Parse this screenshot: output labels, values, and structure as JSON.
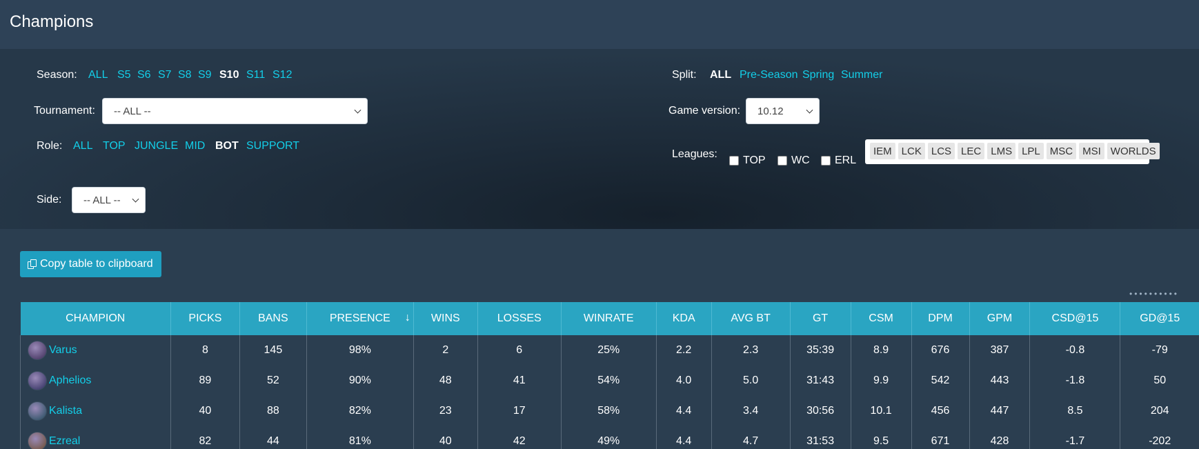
{
  "page": {
    "title": "Champions"
  },
  "filters": {
    "season_label": "Season:",
    "seasons": [
      {
        "label": "ALL",
        "active": false
      },
      {
        "label": "S5",
        "active": false
      },
      {
        "label": "S6",
        "active": false
      },
      {
        "label": "S7",
        "active": false
      },
      {
        "label": "S8",
        "active": false
      },
      {
        "label": "S9",
        "active": false
      },
      {
        "label": "S10",
        "active": true
      },
      {
        "label": "S11",
        "active": false
      },
      {
        "label": "S12",
        "active": false
      }
    ],
    "split_label": "Split:",
    "splits": [
      {
        "label": "ALL",
        "active": true
      },
      {
        "label": "Pre-Season",
        "active": false
      },
      {
        "label": "Spring",
        "active": false
      },
      {
        "label": "Summer",
        "active": false
      }
    ],
    "tournament_label": "Tournament:",
    "tournament_value": "-- ALL --",
    "game_version_label": "Game version:",
    "game_version_value": "10.12",
    "role_label": "Role:",
    "roles": [
      {
        "label": "ALL",
        "active": false
      },
      {
        "label": "TOP",
        "active": false
      },
      {
        "label": "JUNGLE",
        "active": false
      },
      {
        "label": "MID",
        "active": false
      },
      {
        "label": "BOT",
        "active": true
      },
      {
        "label": "SUPPORT",
        "active": false
      }
    ],
    "leagues_label": "Leagues:",
    "league_checkboxes": [
      "TOP",
      "WC",
      "ERL"
    ],
    "league_tags": [
      "IEM",
      "LCK",
      "LCS",
      "LEC",
      "LMS",
      "LPL",
      "MSC",
      "MSI",
      "WORLDS"
    ],
    "side_label": "Side:",
    "side_value": "-- ALL --"
  },
  "actions": {
    "copy_label": "Copy table to clipboard"
  },
  "table": {
    "columns": [
      "CHAMPION",
      "PICKS",
      "BANS",
      "PRESENCE",
      "WINS",
      "LOSSES",
      "WINRATE",
      "KDA",
      "AVG BT",
      "GT",
      "CSM",
      "DPM",
      "GPM",
      "CSD@15",
      "GD@15"
    ],
    "sort_arrow": "↓",
    "rows": [
      {
        "champion": "Varus",
        "cells": [
          "8",
          "145",
          "98%",
          "2",
          "6",
          "25%",
          "2.2",
          "2.3",
          "35:39",
          "8.9",
          "676",
          "387",
          "-0.8",
          "-79"
        ]
      },
      {
        "champion": "Aphelios",
        "cells": [
          "89",
          "52",
          "90%",
          "48",
          "41",
          "54%",
          "4.0",
          "5.0",
          "31:43",
          "9.9",
          "542",
          "443",
          "-1.8",
          "50"
        ]
      },
      {
        "champion": "Kalista",
        "cells": [
          "40",
          "88",
          "82%",
          "23",
          "17",
          "58%",
          "4.4",
          "3.4",
          "30:56",
          "10.1",
          "456",
          "447",
          "8.5",
          "204"
        ]
      },
      {
        "champion": "Ezreal",
        "cells": [
          "82",
          "44",
          "81%",
          "40",
          "42",
          "49%",
          "4.4",
          "4.7",
          "31:53",
          "9.5",
          "671",
          "428",
          "-1.7",
          "-202"
        ]
      }
    ]
  },
  "colors": {
    "accent": "#13cfe9",
    "header": "#2aa5c2",
    "button": "#1f9fc0",
    "background": "#2b3e50"
  },
  "icons": {
    "copy": "copy-icon",
    "caret": "chevron-down-icon",
    "avatar": "champion-avatar"
  }
}
